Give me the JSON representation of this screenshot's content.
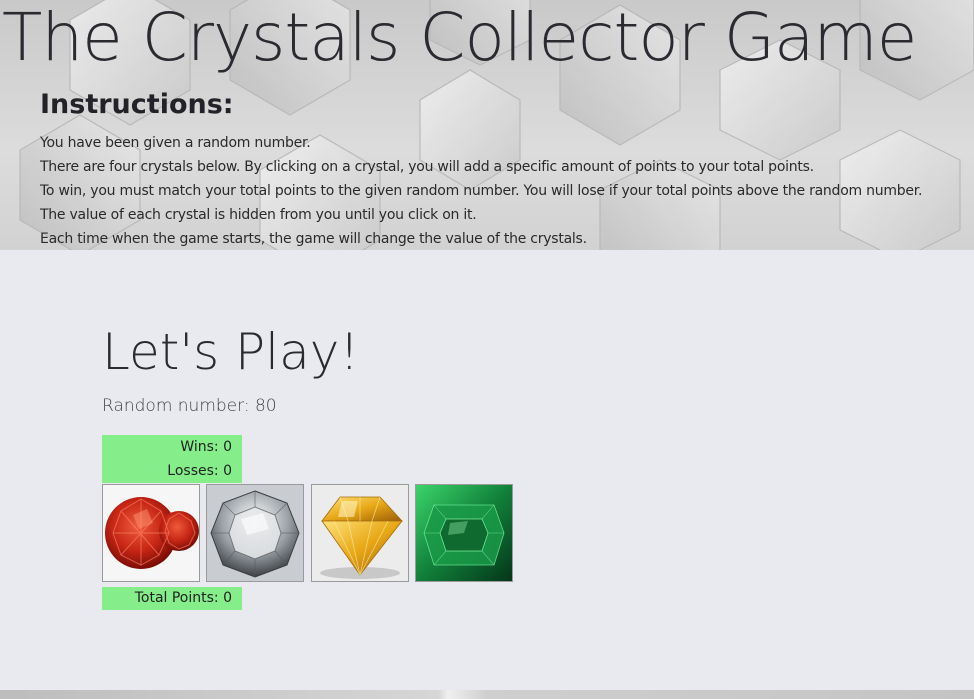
{
  "header": {
    "title": "The Crystals Collector Game",
    "instructions_heading": "Instructions:",
    "instructions": [
      "You have been given a random number.",
      "There are four crystals below. By clicking on a crystal, you will add a specific amount of points to your total points.",
      "To win, you must match your total points to the given random number. You will lose if your total points above the random number.",
      "The value of each crystal is hidden from you until you click on it.",
      "Each time when the game starts, the game will change the value of the crystals."
    ]
  },
  "game": {
    "heading": "Let's Play!",
    "random_number_label": "Random number: 80",
    "wins_label": "Wins: 0",
    "losses_label": "Losses: 0",
    "total_points_label": "Total Points: 0",
    "crystals": [
      {
        "name": "red",
        "icon": "red-crystal-icon"
      },
      {
        "name": "clear",
        "icon": "clear-crystal-icon"
      },
      {
        "name": "yellow",
        "icon": "yellow-crystal-icon"
      },
      {
        "name": "green",
        "icon": "green-crystal-icon"
      }
    ]
  },
  "colors": {
    "panel_background": "#e8eaef",
    "score_box": "#85ee8b",
    "title_text": "#2a2a30"
  }
}
